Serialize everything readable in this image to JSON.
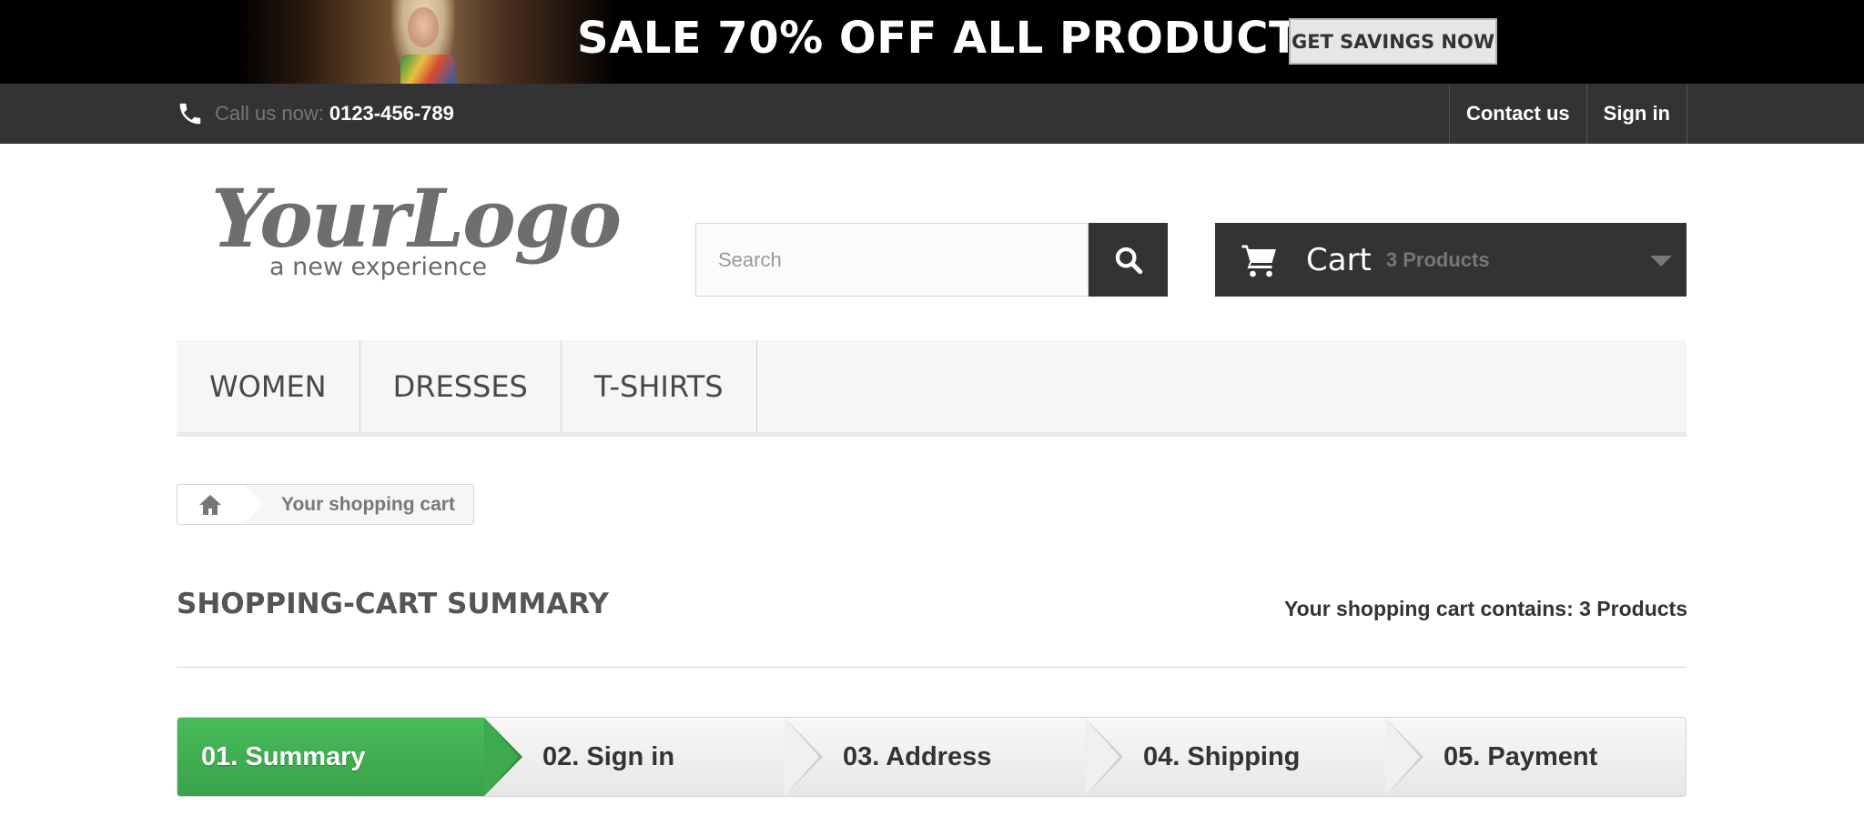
{
  "banner": {
    "text": "SALE 70% OFF ALL PRODUCTS",
    "button": "GET SAVINGS NOW"
  },
  "topbar": {
    "phone_label": "Call us now:",
    "phone_number": "0123-456-789",
    "links": [
      "Contact us",
      "Sign in"
    ]
  },
  "header": {
    "logo_main": "YourLogo",
    "logo_sub": "a new experience",
    "search_placeholder": "Search",
    "cart_label": "Cart",
    "cart_count": "3 Products"
  },
  "menu": {
    "items": [
      "WOMEN",
      "DRESSES",
      "T-SHIRTS"
    ]
  },
  "breadcrumb": {
    "current": "Your shopping cart"
  },
  "page": {
    "title": "SHOPPING-CART SUMMARY",
    "summary": "Your shopping cart contains: 3 Products"
  },
  "steps": [
    {
      "label": "01. Summary",
      "active": true
    },
    {
      "label": "02. Sign in",
      "active": false
    },
    {
      "label": "03. Address",
      "active": false
    },
    {
      "label": "04. Shipping",
      "active": false
    },
    {
      "label": "05. Payment",
      "active": false
    }
  ],
  "colors": {
    "accent_green": "#3aa24a",
    "dark_bar": "#333333",
    "menu_bg": "#f6f6f6"
  }
}
